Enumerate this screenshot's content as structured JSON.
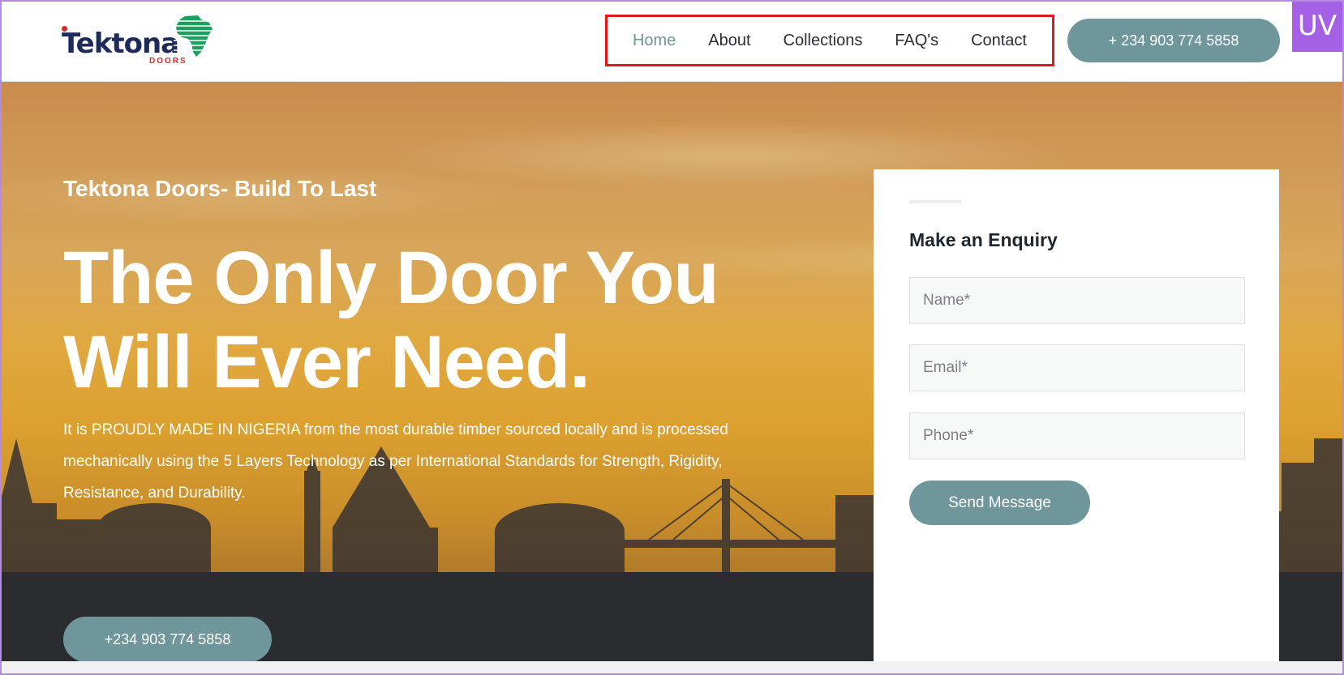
{
  "header": {
    "logo": {
      "name": "Tektona",
      "sub": "DOORS"
    },
    "nav": [
      {
        "label": "Home",
        "active": true
      },
      {
        "label": "About",
        "active": false
      },
      {
        "label": "Collections",
        "active": false
      },
      {
        "label": "FAQ's",
        "active": false
      },
      {
        "label": "Contact",
        "active": false
      }
    ],
    "phone_button": "+ 234 903 774 5858",
    "badge": "UV"
  },
  "hero": {
    "tagline": "Tektona Doors- Build To Last",
    "title_line1": "The Only Door You",
    "title_line2": "Will Ever Need.",
    "description": "It is PROUDLY MADE IN NIGERIA from the most durable timber sourced locally and is processed mechanically using the 5 Layers Technology as per International Standards for Strength, Rigidity, Resistance, and Durability.",
    "phone_button": "+234 903 774 5858"
  },
  "enquiry": {
    "title": "Make an Enquiry",
    "name_placeholder": "Name*",
    "email_placeholder": "Email*",
    "phone_placeholder": "Phone*",
    "submit_label": "Send Message"
  },
  "colors": {
    "accent": "#6e969b",
    "nav_highlight_border": "#e11919",
    "badge": "#a461e6",
    "logo_text": "#1e2a5a"
  }
}
